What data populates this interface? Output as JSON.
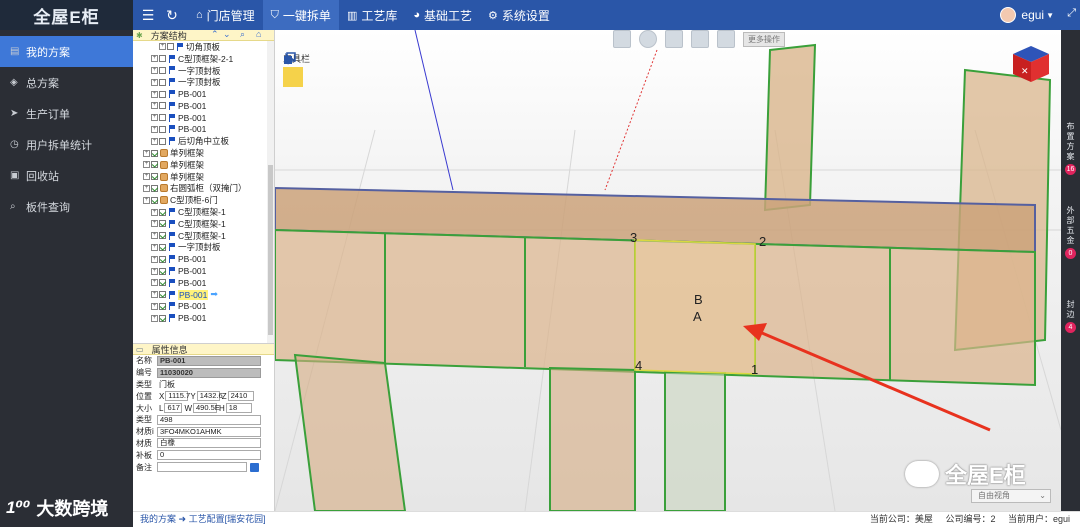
{
  "app": {
    "logo_text": "全屋E柜"
  },
  "topbar": {
    "nav": [
      {
        "label": "门店管理",
        "icon": "house-icon"
      },
      {
        "label": "一键拆单",
        "icon": "shield-icon"
      },
      {
        "label": "工艺库",
        "icon": "bars-icon"
      },
      {
        "label": "基础工艺",
        "icon": "palette-icon"
      },
      {
        "label": "系统设置",
        "icon": "gear-icon"
      }
    ],
    "user": "egui"
  },
  "sidebar": {
    "items": [
      {
        "label": "我的方案",
        "icon": "clipboard-icon"
      },
      {
        "label": "总方案",
        "icon": "gem-icon"
      },
      {
        "label": "生产订单",
        "icon": "send-icon"
      },
      {
        "label": "用户拆单统计",
        "icon": "clock-icon"
      },
      {
        "label": "回收站",
        "icon": "trash-icon"
      },
      {
        "label": "板件查询",
        "icon": "search-icon"
      }
    ],
    "watermark": "大数跨境"
  },
  "tree": {
    "title": "方案结构",
    "rows": [
      {
        "label": "切角顶板",
        "indent": 3,
        "icon": "flag",
        "checked": false
      },
      {
        "label": "C型顶框架-2-1",
        "indent": 2,
        "icon": "flag",
        "checked": false
      },
      {
        "label": "一字顶封板",
        "indent": 2,
        "icon": "flag",
        "checked": false
      },
      {
        "label": "一字顶封板",
        "indent": 2,
        "icon": "flag",
        "checked": false
      },
      {
        "label": "PB-001",
        "indent": 2,
        "icon": "flag",
        "checked": false
      },
      {
        "label": "PB-001",
        "indent": 2,
        "icon": "flag",
        "checked": false
      },
      {
        "label": "PB-001",
        "indent": 2,
        "icon": "flag",
        "checked": false
      },
      {
        "label": "PB-001",
        "indent": 2,
        "icon": "flag",
        "checked": false
      },
      {
        "label": "后切角中立板",
        "indent": 2,
        "icon": "flag",
        "checked": false
      },
      {
        "label": "单列框架",
        "indent": 1,
        "icon": "box",
        "checked": true
      },
      {
        "label": "单列框架",
        "indent": 1,
        "icon": "box",
        "checked": true
      },
      {
        "label": "单列框架",
        "indent": 1,
        "icon": "box",
        "checked": true
      },
      {
        "label": "右圆弧柜（双掩门）",
        "indent": 1,
        "icon": "box",
        "checked": true
      },
      {
        "label": "C型顶柜-6门",
        "indent": 1,
        "icon": "box",
        "checked": true
      },
      {
        "label": "C型顶框架-1",
        "indent": 2,
        "icon": "flag",
        "checked": true
      },
      {
        "label": "C型顶框架-1",
        "indent": 2,
        "icon": "flag",
        "checked": true
      },
      {
        "label": "C型顶框架-1",
        "indent": 2,
        "icon": "flag",
        "checked": true
      },
      {
        "label": "一字顶封板",
        "indent": 2,
        "icon": "flag",
        "checked": true
      },
      {
        "label": "PB-001",
        "indent": 2,
        "icon": "flag",
        "checked": true
      },
      {
        "label": "PB-001",
        "indent": 2,
        "icon": "flag",
        "checked": true
      },
      {
        "label": "PB-001",
        "indent": 2,
        "icon": "flag",
        "checked": true
      },
      {
        "label": "PB-001",
        "indent": 2,
        "icon": "flag",
        "checked": true,
        "selected": true
      },
      {
        "label": "PB-001",
        "indent": 2,
        "icon": "flag",
        "checked": true
      },
      {
        "label": "PB-001",
        "indent": 2,
        "icon": "flag",
        "checked": true
      }
    ]
  },
  "props": {
    "title": "属性信息",
    "name_label": "名称",
    "name": "PB-001",
    "code_label": "编号",
    "code": "11030020",
    "type_label": "类型",
    "type": "门板",
    "pos_label": "位置",
    "x": "1115.7",
    "y": "1432.6",
    "z": "2410",
    "size_label": "大小",
    "l": "617",
    "w": "490.5E",
    "h": "18",
    "kind_label": "类型",
    "kind": "498",
    "material_code_label": "材质i",
    "material_code": "3FO4MKO1AHMK",
    "material_label": "材质",
    "material": "白橡",
    "supp_label": "补板",
    "supp": "0",
    "note_label": "备注",
    "note": ""
  },
  "toolbox": {
    "title": "工具栏"
  },
  "viewport": {
    "more_ops": "更多操作",
    "view_mode": "自由视角",
    "point_labels": [
      "1",
      "2",
      "3",
      "4",
      "A",
      "B"
    ],
    "watermark": "全屋E柜"
  },
  "rightbar": [
    {
      "label": "布置方案",
      "count": "16"
    },
    {
      "label": "外部五金",
      "count": "0"
    },
    {
      "label": "封边",
      "count": "4"
    }
  ],
  "footer": {
    "breadcrumb_1": "我的方案",
    "breadcrumb_2": "工艺配置[瑞安花园]",
    "company": "当前公司：美屋",
    "company_code": "公司编号：2",
    "current_user": "当前用户：egui"
  }
}
